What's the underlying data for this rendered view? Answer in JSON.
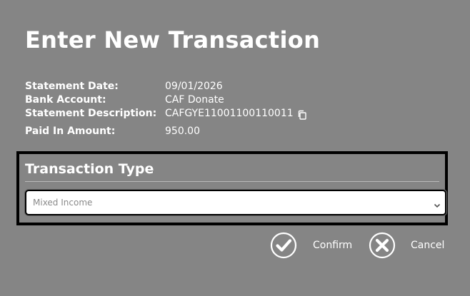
{
  "dialog": {
    "title": "Enter New Transaction"
  },
  "details": {
    "statement_date": {
      "label": "Statement Date:",
      "value": "09/01/2026"
    },
    "bank_account": {
      "label": "Bank Account:",
      "value": "CAF Donate"
    },
    "statement_description": {
      "label": "Statement Description:",
      "value": "CAFGYE11001100110011",
      "icon": "copy-icon"
    },
    "paid_in_amount": {
      "label": "Paid In Amount:",
      "value": "950.00"
    }
  },
  "transaction_type": {
    "heading": "Transaction Type",
    "selected": "Mixed Income",
    "chevron_icon": "chevron-down-icon"
  },
  "actions": {
    "confirm_label": "Confirm",
    "confirm_icon": "check-circle-icon",
    "cancel_label": "Cancel",
    "cancel_icon": "x-circle-icon"
  },
  "colors": {
    "background": "#858585",
    "text": "#ffffff",
    "box_border": "#000000",
    "select_text": "#8a8a8a"
  }
}
